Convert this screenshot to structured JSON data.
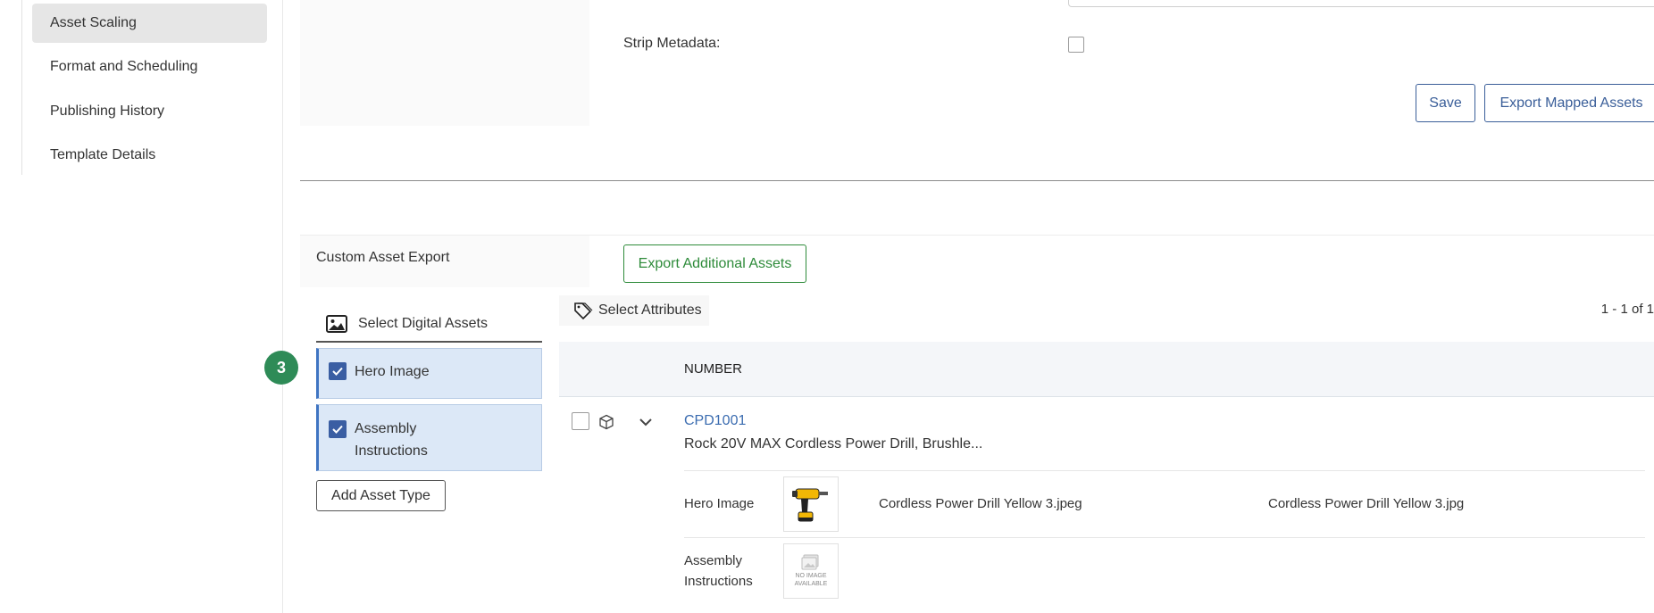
{
  "sidebar": {
    "items": [
      {
        "label": "Asset Scaling",
        "active": true
      },
      {
        "label": "Format and Scheduling",
        "active": false
      },
      {
        "label": "Publishing History",
        "active": false
      },
      {
        "label": "Template Details",
        "active": false
      }
    ]
  },
  "settings": {
    "strip_metadata_label": "Strip Metadata:",
    "strip_metadata_checked": false,
    "save_label": "Save",
    "export_mapped_label": "Export Mapped Assets"
  },
  "custom_export": {
    "title": "Custom Asset Export",
    "export_additional_label": "Export Additional Assets"
  },
  "assets": {
    "tab_label": "Select Digital Assets",
    "step_badge": "3",
    "items": [
      {
        "label": "Hero Image",
        "checked": true
      },
      {
        "label_line1": "Assembly",
        "label_line2": "Instructions",
        "checked": true
      }
    ],
    "add_label": "Add Asset Type"
  },
  "table": {
    "select_attributes_label": "Select Attributes",
    "pager": "1 - 1 of 1",
    "column_number": "NUMBER",
    "rows": [
      {
        "number": "CPD1001",
        "description": "Rock 20V MAX Cordless Power Drill, Brushle...",
        "assets": [
          {
            "type": "Hero Image",
            "file": "Cordless Power Drill Yellow 3.jpeg",
            "file2": "Cordless Power Drill Yellow 3.jpg"
          },
          {
            "type_line1": "Assembly",
            "type_line2": "Instructions",
            "placeholder_line1": "NO IMAGE",
            "placeholder_line2": "AVAILABLE"
          }
        ]
      }
    ]
  },
  "colors": {
    "accent_blue": "#3a5e99",
    "accent_green": "#2e8b3a",
    "badge_green": "#2e8b57",
    "selected_bg": "#dce8f7"
  }
}
